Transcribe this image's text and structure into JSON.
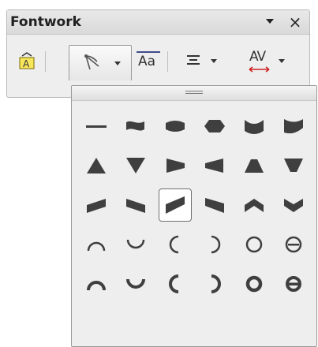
{
  "toolbar": {
    "title": "Fontwork",
    "menu_icon": "chevron-down-icon",
    "close_label": "×",
    "buttons": [
      {
        "name": "fontwork-gallery-button",
        "icon": "fontwork-gallery-icon"
      },
      {
        "name": "fontwork-shape-button",
        "icon": "fontwork-shape-icon"
      },
      {
        "name": "same-letter-heights-button",
        "icon": "letter-heights-icon",
        "label": "Aa"
      },
      {
        "name": "alignment-button",
        "icon": "align-center-icon"
      },
      {
        "name": "character-spacing-button",
        "icon": "character-spacing-icon",
        "label": "AV"
      }
    ]
  },
  "shapes_panel": {
    "selected": "row 3, column 3",
    "rows": [
      [
        "Plain Text",
        "Wave",
        "Inflate",
        "Stop",
        "Curve Down",
        "Curve Up"
      ],
      [
        "Triangle Up",
        "Triangle Down",
        "Fade Right",
        "Fade Left",
        "Fade Up",
        "Fade Down"
      ],
      [
        "Slant Up",
        "Slant Down",
        "Fade Up and Right",
        "Fade Up and Left",
        "Chevron Up",
        "Chevron Down"
      ],
      [
        "Arch Up (Curve)",
        "Arch Down (Curve)",
        "Arch Left (Curve)",
        "Arch Right (Curve)",
        "Circle (Curve)",
        "Open Circle (Curve)"
      ],
      [
        "Arch Up (Pour)",
        "Arch Down (Pour)",
        "Arch Left (Pour)",
        "Arch Right (Pour)",
        "Circle (Pour)",
        "Open Circle (Pour)"
      ]
    ]
  },
  "colors": {
    "shape_fill": "#3f3f3f",
    "accent_red": "#d02020"
  }
}
